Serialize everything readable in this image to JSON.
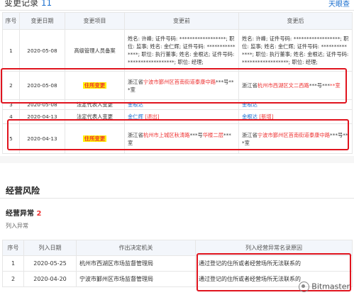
{
  "change_section": {
    "title": "变更记录",
    "count": "11",
    "logo_text": "天眼查",
    "headers": [
      "序号",
      "变更日期",
      "变更项目",
      "变更前",
      "变更后"
    ],
    "rows": [
      {
        "no": "1",
        "date": "2020-05-08",
        "item": "高级管理人员备案",
        "before": "姓名: 许峰; 证件号码: ******************; 职位: 监事; 姓名: 金仁辉; 证件号码: ***************; 职位: 执行董事; 姓名: 金根达; 证件号码: ******************; 职位: 经理;",
        "after": "姓名: 许峰; 证件号码: ******************; 职位: 监事; 姓名: 金仁辉; 证件号码: **************; 职位: 执行董事; 姓名: 金根达; 证件号码: ******************; 职位: 经理;"
      },
      {
        "no": "2",
        "date": "2020-05-08",
        "item": "住所变更",
        "before_p1": "浙江省",
        "before_hl1": "宁波市鄞州区",
        "before_p2": "首南街道泰康中路",
        "before_p3": "***号***室",
        "after_p1": "浙江省",
        "after_hl1": "杭州市西湖区",
        "after_p2": "文二西路",
        "after_p3": "***号***",
        "after_p4": "**室"
      },
      {
        "no": "3",
        "date": "2020-05-08",
        "item": "法定代表人变更",
        "before": "金根达",
        "after": "金根达"
      },
      {
        "no": "4",
        "date": "2020-04-13",
        "item": "法定代表人变更",
        "before": "金仁辉",
        "before_tag": "[退出]",
        "after": "金根达",
        "after_tag": "[新增]"
      },
      {
        "no": "5",
        "date": "2020-04-13",
        "item": "住所变更",
        "before_p1": "浙江省",
        "before_hl1": "杭州市上城区",
        "before_p2": "秋涛路",
        "before_p3": "***号",
        "before_p4": "华楼二层",
        "before_p5": "***室",
        "after_p1": "浙江省",
        "after_hl1": "宁波市鄞州区",
        "after_p2": "首南街道泰康中路",
        "after_p3": "***号***室"
      }
    ]
  },
  "risk_section": {
    "title": "经营风险",
    "sub_title": "经营异常",
    "sub_count": "2",
    "list_label": "列入异常",
    "headers": [
      "序号",
      "列入日期",
      "作出决定机关",
      "列入经营异常名录原因"
    ],
    "rows": [
      {
        "no": "1",
        "date": "2020-05-25",
        "org": "杭州市西湖区市场监督管理局",
        "reason": "通过登记的住所或者经营场所无法联系的"
      },
      {
        "no": "2",
        "date": "2020-04-20",
        "org": "宁波市鄞州区市场监督管理局",
        "reason": "通过登记的住所或者经营场所无法联系的"
      }
    ]
  },
  "watermark": {
    "text": "Bitmaster"
  },
  "colors": {
    "accent_blue": "#1a6fcf",
    "highlight_red": "#e0141e",
    "highlight_yellow": "#fff200"
  }
}
